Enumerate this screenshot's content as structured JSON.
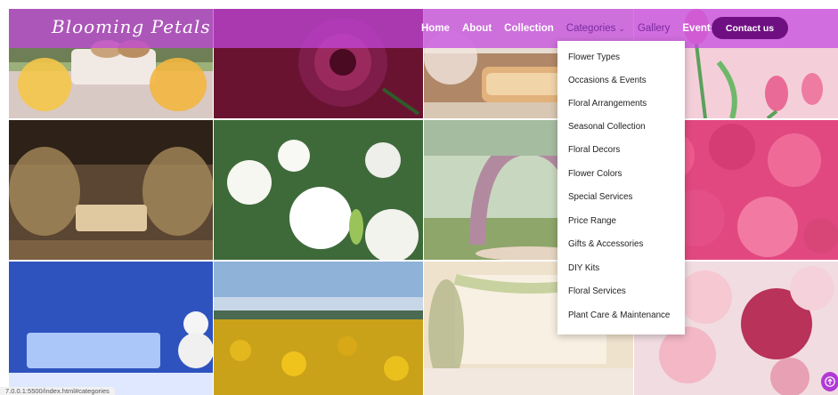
{
  "header": {
    "logo_text": "Blooming Petals",
    "nav": {
      "home": "Home",
      "about": "About",
      "collection": "Collection",
      "categories": "Categories",
      "gallery": "Gallery",
      "events": "Events"
    },
    "contact_label": "Contact us"
  },
  "categories_menu": {
    "items": [
      "Flower Types",
      "Occasions & Events",
      "Floral Arrangements",
      "Seasonal Collection",
      "Floral Decors",
      "Flower Colors",
      "Special Services",
      "Price Range",
      "Gifts & Accessories",
      "DIY Kits",
      "Floral Services",
      "Plant Care & Maintenance"
    ]
  },
  "status_bar": {
    "url": "7.0.0.1:5500/index.html#categories"
  },
  "gallery": {
    "tiles": [
      {
        "subject": "wedding-stage-white-floral"
      },
      {
        "subject": "dark-magenta-dahlia"
      },
      {
        "subject": "ornate-gold-sofa-stage"
      },
      {
        "subject": "pink-tulips"
      },
      {
        "subject": "pampas-grass-stage"
      },
      {
        "subject": "white-lilies"
      },
      {
        "subject": "floral-arch-garden"
      },
      {
        "subject": "pink-roses"
      },
      {
        "subject": "winter-blue-stage"
      },
      {
        "subject": "sunflower-field"
      },
      {
        "subject": "draped-floral-stage"
      },
      {
        "subject": "pink-peonies"
      }
    ]
  },
  "colors": {
    "navbar": "#c446e0",
    "contact_button": "#6f1082",
    "active_nav": "#7a2aa0"
  }
}
